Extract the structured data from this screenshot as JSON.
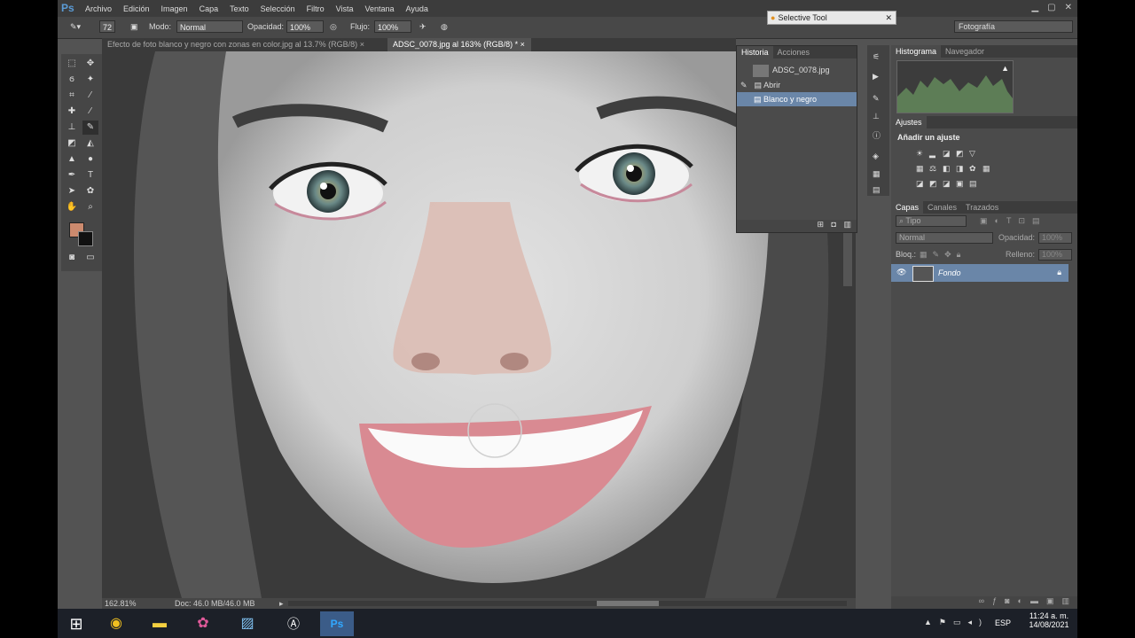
{
  "app": {
    "logo": "Ps",
    "menu": [
      "Archivo",
      "Edición",
      "Imagen",
      "Capa",
      "Texto",
      "Selección",
      "Filtro",
      "Vista",
      "Ventana",
      "Ayuda"
    ]
  },
  "options": {
    "brush_size": "72",
    "mode_label": "Modo:",
    "mode_value": "Normal",
    "opacity_label": "Opacidad:",
    "opacity_value": "100%",
    "flow_label": "Flujo:",
    "flow_value": "100%",
    "workspace": "Fotografía"
  },
  "floating": {
    "selective_tool": "Selective Tool"
  },
  "doc_tabs": [
    {
      "label": "Efecto de foto blanco y negro con zonas en color.jpg al 13.7% (RGB/8)"
    },
    {
      "label": "ADSC_0078.jpg al 163% (RGB/8) *"
    }
  ],
  "history_panel": {
    "tabs": [
      "Historia",
      "Acciones"
    ],
    "snapshot": "ADSC_0078.jpg",
    "items": [
      "Abrir",
      "Blanco y negro"
    ]
  },
  "histogram_panel": {
    "tabs": [
      "Histograma",
      "Navegador"
    ]
  },
  "adjustments": {
    "title": "Ajustes",
    "subtitle": "Añadir un ajuste"
  },
  "layers_panel": {
    "tabs": [
      "Capas",
      "Canales",
      "Trazados"
    ],
    "filter": "Tipo",
    "blend_mode": "Normal",
    "opacity_label": "Opacidad:",
    "opacity_value": "100%",
    "lock_label": "Bloq.:",
    "fill_label": "Relleno:",
    "fill_value": "100%",
    "layer_name": "Fondo"
  },
  "status": {
    "zoom": "162.81%",
    "doc": "Doc: 46.0 MB/46.0 MB"
  },
  "taskbar": {
    "lang": "ESP",
    "time": "11:24 a. m.",
    "date": "14/08/2021"
  }
}
